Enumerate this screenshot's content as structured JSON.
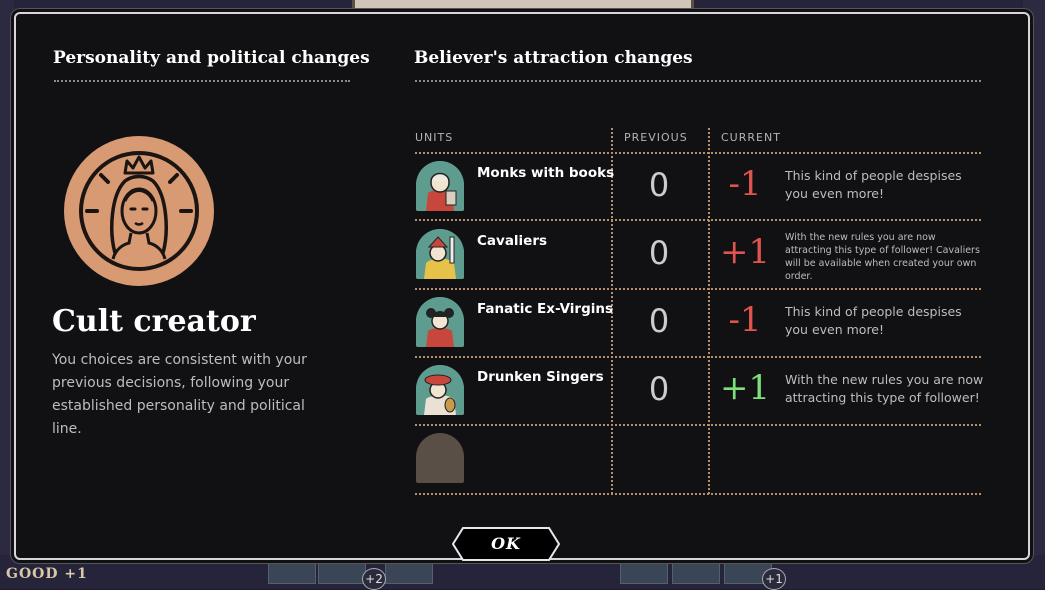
{
  "background": {
    "good_label": "GOOD +1",
    "bubble_left": "+2",
    "bubble_right": "+1"
  },
  "left_panel": {
    "title": "Personality and political changes",
    "medal_icon": "crowned-woman-medal-icon",
    "cult_name": "Cult creator",
    "description": "You choices are consistent with your previous decisions, following your established personality and political line."
  },
  "right_panel": {
    "title": "Believer's attraction changes",
    "headers": {
      "units": "UNITS",
      "previous": "PREVIOUS",
      "current": "CURRENT"
    },
    "rows": [
      {
        "name": "Monks with books",
        "previous": "0",
        "current": "-1",
        "current_color": "#e0544f",
        "note": "This kind of people despises you even more!",
        "portrait_icon": "monk-portrait-icon"
      },
      {
        "name": "Cavaliers",
        "previous": "0",
        "current": "+1",
        "current_color": "#e0544f",
        "note": "With the new rules you are now attracting this type of follower! Cavaliers will be available when created your own order.",
        "portrait_icon": "cavalier-portrait-icon"
      },
      {
        "name": "Fanatic Ex-Virgins",
        "previous": "0",
        "current": "-1",
        "current_color": "#e0544f",
        "note": "This kind of people despises you even more!",
        "portrait_icon": "ex-virgin-portrait-icon"
      },
      {
        "name": "Drunken Singers",
        "previous": "0",
        "current": "+1",
        "current_color": "#7ee07a",
        "note": "With the new rules you are now attracting this type of follower!",
        "portrait_icon": "singer-portrait-icon"
      }
    ]
  },
  "ok_button": {
    "label": "OK"
  },
  "colors": {
    "dialog_bg": "#111114",
    "negative": "#e0544f",
    "positive": "#7ee07a",
    "medal": "#d79a73"
  }
}
